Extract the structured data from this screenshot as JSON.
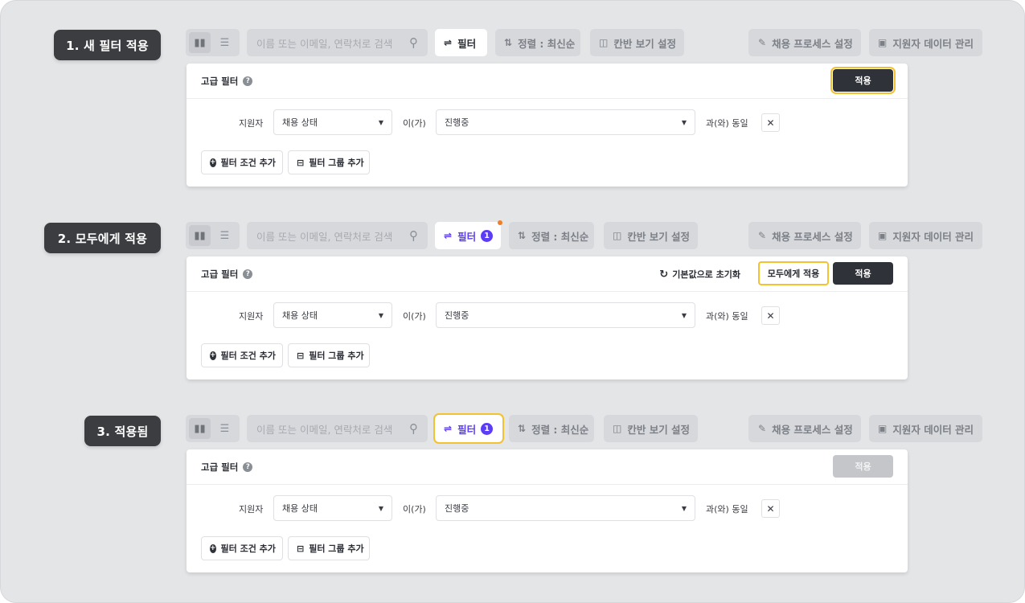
{
  "colors": {
    "accent": "#5b3df5",
    "highlight": "#f2c230",
    "primary_button": "#2f3239",
    "notify_dot": "#f07d2a"
  },
  "toolbar": {
    "search_placeholder": "이름 또는 이메일, 연락처로 검색",
    "filter_label": "필터",
    "filter_count": "1",
    "sort_label": "정렬 : 최신순",
    "kanban_label": "칸반 보기 설정",
    "process_label": "채용 프로세스 설정",
    "data_label": "지원자 데이터 관리",
    "icons": {
      "board": "board-view-icon",
      "list": "list-view-icon",
      "search": "search-icon",
      "filter": "filter-sliders-icon",
      "sort": "sort-arrows-icon",
      "kanban": "kanban-icon",
      "pencil": "pencil-icon",
      "data": "upload-box-icon"
    }
  },
  "panel": {
    "title": "고급 필터",
    "help": "?",
    "apply_label": "적용",
    "apply_all_label": "모두에게 적용",
    "reset_label": "기본값으로 초기화",
    "row": {
      "subject": "지원자",
      "field": "채용 상태",
      "connector": "이(가)",
      "value": "진행중",
      "operator": "과(와) 동일",
      "remove": "✕"
    },
    "add_condition": "필터 조건 추가",
    "add_group": "필터 그룹 추가"
  },
  "steps": [
    {
      "label": "1. 새 필터 적용"
    },
    {
      "label": "2. 모두에게 적용"
    },
    {
      "label": "3. 적용됨"
    }
  ]
}
